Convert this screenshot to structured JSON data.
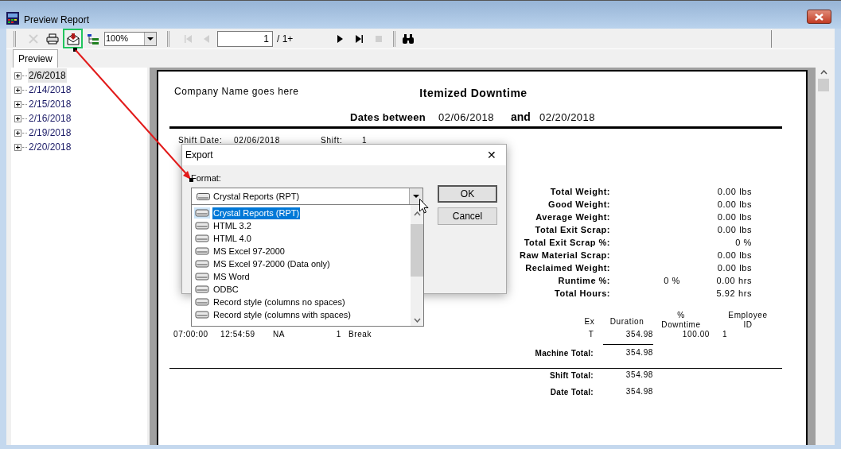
{
  "window": {
    "title": "Preview Report"
  },
  "toolbar": {
    "buttons": [
      {
        "kind": "cancel",
        "disabled": true
      },
      {
        "kind": "print",
        "disabled": false
      },
      {
        "kind": "export",
        "disabled": false,
        "highlighted": true
      },
      {
        "kind": "tree",
        "disabled": false
      },
      {
        "kind": "first",
        "disabled": true
      },
      {
        "kind": "prev",
        "disabled": true
      },
      {
        "kind": "next",
        "disabled": false
      },
      {
        "kind": "last",
        "disabled": false
      },
      {
        "kind": "stop",
        "disabled": true
      },
      {
        "kind": "find",
        "disabled": false
      }
    ],
    "zoom": "100%",
    "page": "1",
    "page_count": "/ 1+"
  },
  "tabs": [
    {
      "label": "Preview",
      "selected": true
    }
  ],
  "tree": {
    "items": [
      {
        "label": "2/6/2018",
        "selected": true,
        "expanded": false
      },
      {
        "label": "2/14/2018",
        "selected": false,
        "expanded": false
      },
      {
        "label": "2/15/2018",
        "selected": false,
        "expanded": false
      },
      {
        "label": "2/16/2018",
        "selected": false,
        "expanded": false
      },
      {
        "label": "2/19/2018",
        "selected": false,
        "expanded": false
      },
      {
        "label": "2/20/2018",
        "selected": false,
        "expanded": false
      }
    ]
  },
  "report": {
    "company": "Company Name goes here",
    "title": "Itemized Downtime",
    "date_range": {
      "label": "Dates between",
      "from": "02/06/2018",
      "joiner": "and",
      "to": "02/20/2018"
    },
    "shift_header": [
      {
        "label": "Shift Date:",
        "value": "02/06/2018"
      },
      {
        "label": "Shift:",
        "value": "1"
      }
    ],
    "stats": [
      {
        "label": "Total Weight:",
        "value": "0.00 lbs"
      },
      {
        "label": "Good Weight:",
        "value": "0.00 lbs"
      },
      {
        "label": "Average Weight:",
        "value": "0.00 lbs"
      },
      {
        "label": "Total Exit Scrap:",
        "value": "0.00 lbs"
      },
      {
        "label": "Total Exit Scrap %:",
        "value": "0 %"
      },
      {
        "label": "Raw Material Scrap:",
        "value": "0.00 lbs"
      },
      {
        "label": "Reclaimed Weight:",
        "value": "0.00 lbs"
      },
      {
        "label": "Runtime %:",
        "percent": "0 %",
        "value": "0.00 hrs"
      },
      {
        "label": "Total Hours:",
        "value": "5.92 hrs"
      }
    ],
    "columns": [
      "",
      "",
      "",
      "",
      "",
      "Ex",
      "Duration",
      "%\nDowntime",
      "Employee\nID"
    ],
    "rows": [
      [
        "07:00:00",
        "12:54:59",
        "NA",
        "1",
        "Break",
        "T",
        "354.98",
        "100.00",
        "1"
      ]
    ],
    "totals": [
      {
        "label": "Machine Total:",
        "value": "354.98"
      },
      {
        "label": "Shift Total:",
        "value": "354.98"
      },
      {
        "label": "Date Total:",
        "value": "354.98"
      }
    ]
  },
  "dialog": {
    "title": "Export",
    "close": "✕",
    "format_label": "Format:",
    "format_value": "Crystal Reports (RPT)",
    "buttons": [
      "OK",
      "Cancel"
    ],
    "options": [
      {
        "label": "Crystal Reports (RPT)",
        "selected": true
      },
      {
        "label": "HTML 3.2",
        "selected": false
      },
      {
        "label": "HTML 4.0",
        "selected": false
      },
      {
        "label": "MS Excel 97-2000",
        "selected": false
      },
      {
        "label": "MS Excel 97-2000 (Data only)",
        "selected": false
      },
      {
        "label": "MS Word",
        "selected": false
      },
      {
        "label": "ODBC",
        "selected": false
      },
      {
        "label": "Record style (columns no spaces)",
        "selected": false
      },
      {
        "label": "Record style (columns with spaces)",
        "selected": false
      }
    ]
  }
}
